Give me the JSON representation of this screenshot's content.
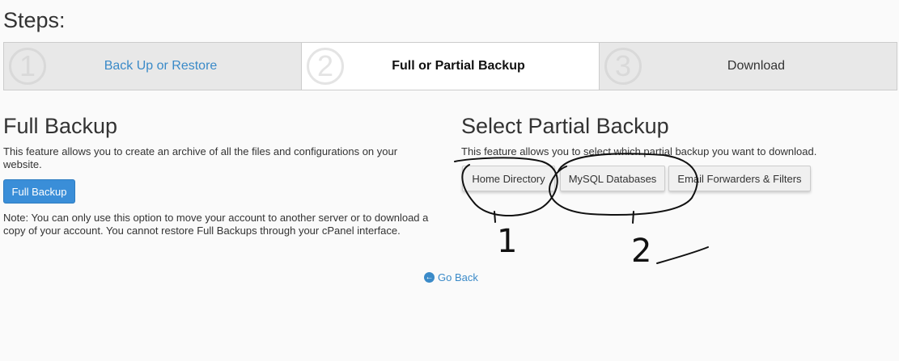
{
  "page": {
    "heading": "Steps:"
  },
  "steps": [
    {
      "number": "1",
      "label": "Back Up or Restore",
      "state": "link"
    },
    {
      "number": "2",
      "label": "Full or Partial Backup",
      "state": "active"
    },
    {
      "number": "3",
      "label": "Download",
      "state": "inactive"
    }
  ],
  "full_backup": {
    "title": "Full Backup",
    "description": "This feature allows you to create an archive of all the files and configurations on your website.",
    "button_label": "Full Backup",
    "note": "Note: You can only use this option to move your account to another server or to download a copy of your account. You cannot restore Full Backups through your cPanel interface."
  },
  "partial_backup": {
    "title": "Select Partial Backup",
    "description": "This feature allows you to select which partial backup you want to download.",
    "buttons": [
      "Home Directory",
      "MySQL Databases",
      "Email Forwarders & Filters"
    ]
  },
  "footer": {
    "go_back_label": "Go Back",
    "go_back_icon": "arrow-left-circle-icon"
  },
  "annotations": {
    "mark_1": "1",
    "mark_2": "2"
  },
  "colors": {
    "accent": "#3a8ed8",
    "link": "#3a8ac8",
    "scribble": "#111111"
  }
}
